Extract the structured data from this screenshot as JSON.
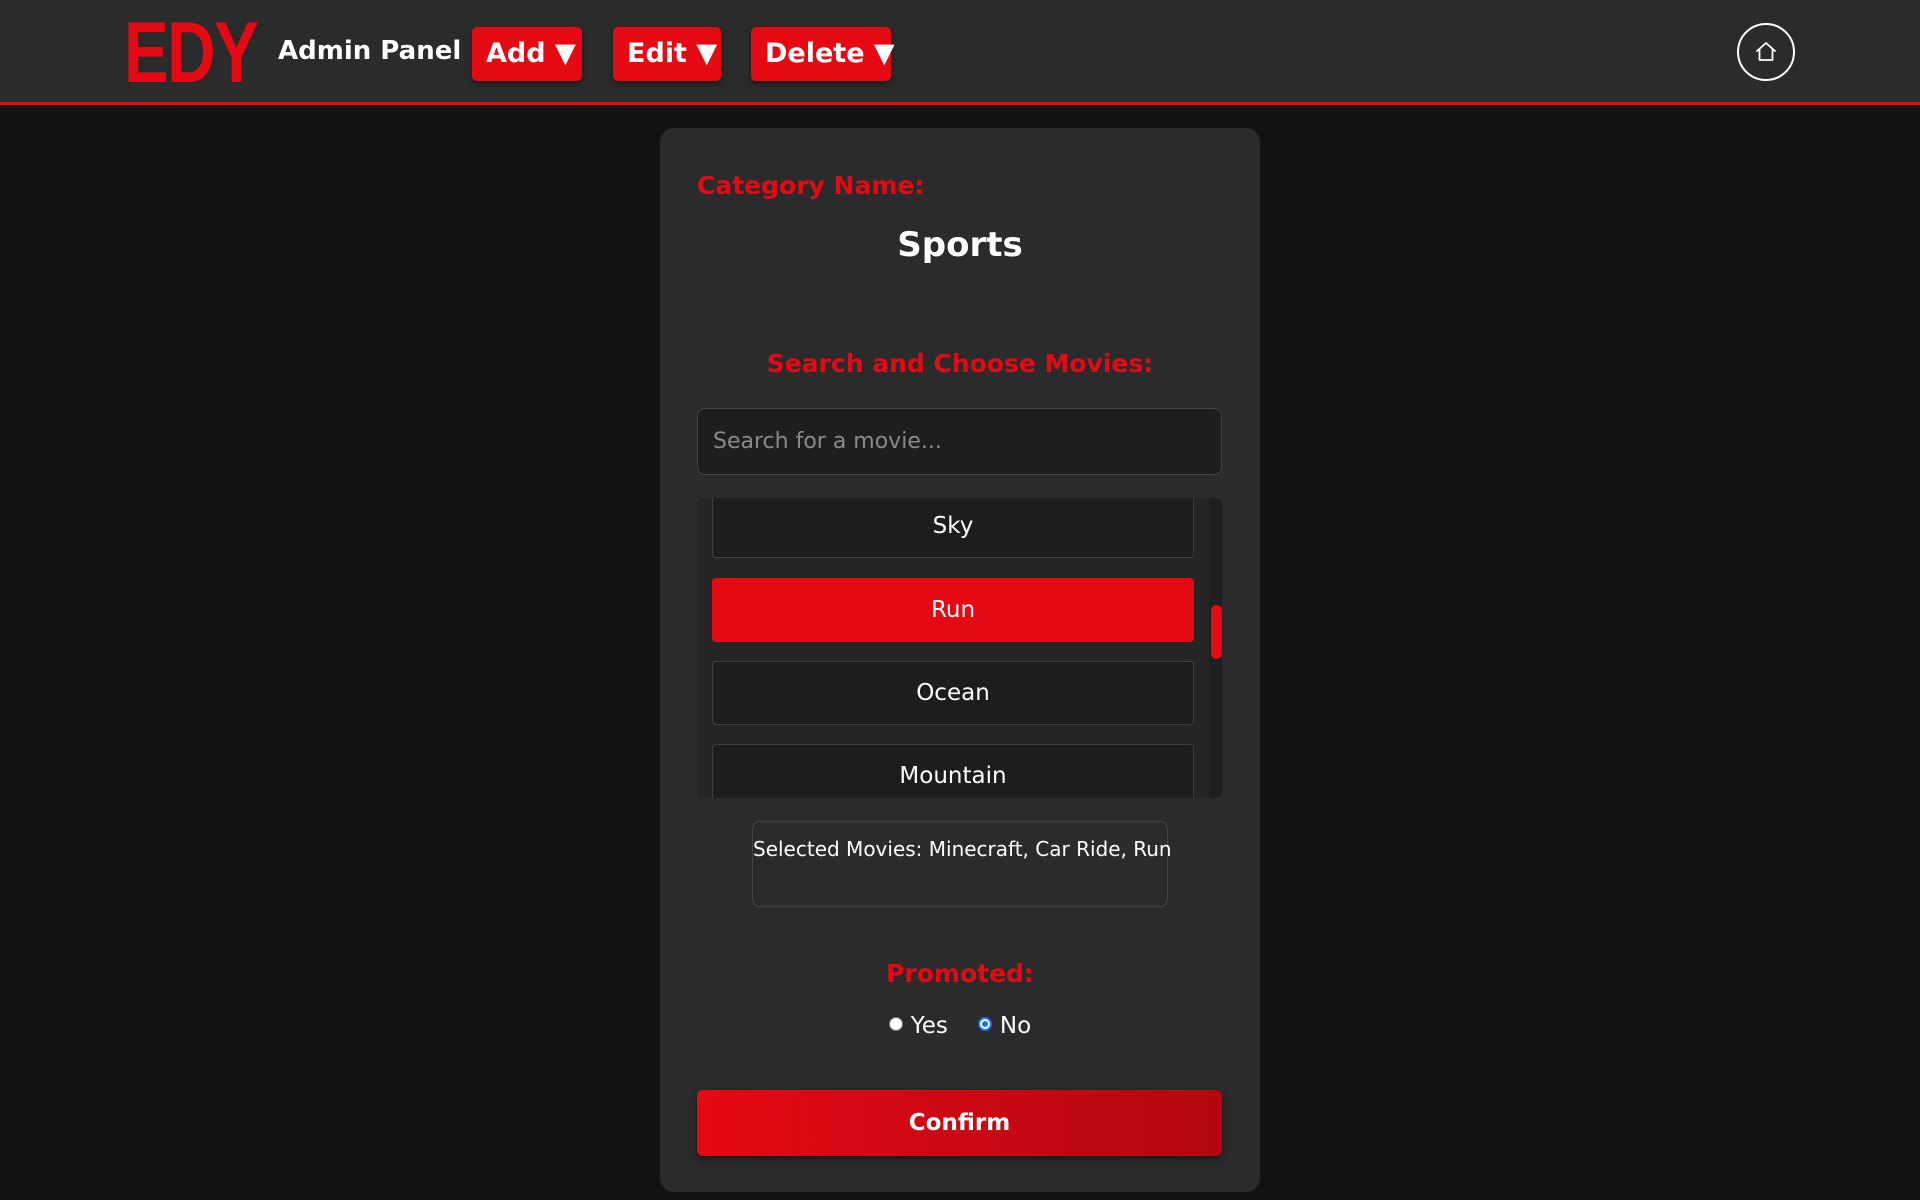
{
  "header": {
    "logo": "EDY",
    "title": "Admin Panel",
    "nav": [
      {
        "label": "Add ▼"
      },
      {
        "label": "Edit ▼"
      },
      {
        "label": "Delete ▼"
      }
    ],
    "home_icon": "home-icon"
  },
  "form": {
    "category_label": "Category Name:",
    "category_value": "Sports",
    "search_label": "Search and Choose Movies:",
    "search_placeholder": "Search for a movie...",
    "search_value": "",
    "movies": [
      {
        "title": "Sky",
        "selected": false
      },
      {
        "title": "Run",
        "selected": true
      },
      {
        "title": "Ocean",
        "selected": false
      },
      {
        "title": "Mountain",
        "selected": false
      }
    ],
    "selected_movies_text": "Selected Movies: Minecraft, Car Ride, Run",
    "promoted_label": "Promoted:",
    "promoted_options": [
      {
        "label": "Yes",
        "checked": false
      },
      {
        "label": "No",
        "checked": true
      }
    ],
    "confirm_label": "Confirm"
  },
  "colors": {
    "accent": "#e50914",
    "background": "#131313",
    "panel": "#2b2b2b",
    "radio_checked": "#1a73e8"
  }
}
